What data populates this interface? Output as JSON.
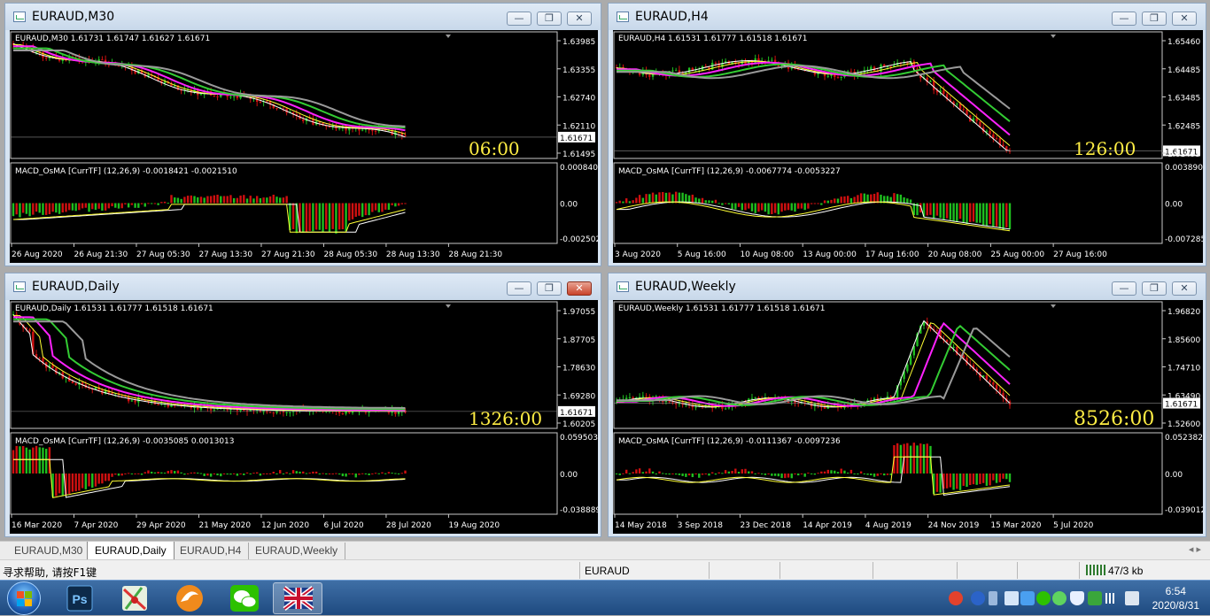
{
  "windows": [
    {
      "id": "m30",
      "title": "EURAUD,M30",
      "info": "EURAUD,M30  1.61731 1.61747 1.61627 1.61671",
      "prices": [
        "1.63985",
        "1.63355",
        "1.62740",
        "1.62110",
        "1.61495"
      ],
      "current_price": "1.61671",
      "countdown": "06:00",
      "macd_label": "MACD_OsMA [CurrTF] (12,26,9) -0.0018421 -0.0021510",
      "macd_scale": [
        "0.0008403",
        "0.00",
        "-0.002502"
      ],
      "dates": [
        "26 Aug 2020",
        "26 Aug 21:30",
        "27 Aug 05:30",
        "27 Aug 13:30",
        "27 Aug 21:30",
        "28 Aug 05:30",
        "28 Aug 13:30",
        "28 Aug 21:30"
      ],
      "active_close": false
    },
    {
      "id": "h4",
      "title": "EURAUD,H4",
      "info": "EURAUD,H4  1.61531 1.61777 1.61518 1.61671",
      "prices": [
        "1.65460",
        "1.64485",
        "1.63485",
        "1.62485",
        "1.61495"
      ],
      "current_price": "1.61671",
      "countdown": "126:00",
      "macd_label": "MACD_OsMA [CurrTF] (12,26,9) -0.0067774 -0.0053227",
      "macd_scale": [
        "0.0038903",
        "0.00",
        "-0.007285"
      ],
      "dates": [
        "3 Aug 2020",
        "5 Aug 16:00",
        "10 Aug 08:00",
        "13 Aug 00:00",
        "17 Aug 16:00",
        "20 Aug 08:00",
        "25 Aug 00:00",
        "27 Aug 16:00"
      ],
      "active_close": false
    },
    {
      "id": "daily",
      "title": "EURAUD,Daily",
      "info": "EURAUD,Daily  1.61531 1.61777 1.61518 1.61671",
      "prices": [
        "1.97055",
        "1.87705",
        "1.78630",
        "1.69280",
        "1.60205"
      ],
      "current_price": "1.61671",
      "countdown": "1326:00",
      "macd_label": "MACD_OsMA [CurrTF] (12,26,9) -0.0035085 0.0013013",
      "macd_scale": [
        "0.0595038",
        "0.00",
        "-0.038889"
      ],
      "dates": [
        "16 Mar 2020",
        "7 Apr 2020",
        "29 Apr 2020",
        "21 May 2020",
        "12 Jun 2020",
        "6 Jul 2020",
        "28 Jul 2020",
        "19 Aug 2020"
      ],
      "active_close": true
    },
    {
      "id": "weekly",
      "title": "EURAUD,Weekly",
      "info": "EURAUD,Weekly  1.61531 1.61777 1.61518 1.61671",
      "prices": [
        "1.96820",
        "1.85600",
        "1.74710",
        "1.63490",
        "1.52600"
      ],
      "current_price": "1.61671",
      "countdown": "8526:00",
      "macd_label": "MACD_OsMA [CurrTF] (12,26,9) -0.0111367 -0.0097236",
      "macd_scale": [
        "0.0523829",
        "0.00",
        "-0.039012"
      ],
      "dates": [
        "14 May 2018",
        "3 Sep 2018",
        "23 Dec 2018",
        "14 Apr 2019",
        "4 Aug 2019",
        "24 Nov 2019",
        "15 Mar 2020",
        "5 Jul 2020"
      ],
      "active_close": false
    }
  ],
  "window_buttons": {
    "minimize": "—",
    "restore": "❐",
    "close": "✕"
  },
  "tabs": [
    {
      "label": "EURAUD,M30",
      "active": false
    },
    {
      "label": "EURAUD,Daily",
      "active": true
    },
    {
      "label": "EURAUD,H4",
      "active": false
    },
    {
      "label": "EURAUD,Weekly",
      "active": false
    }
  ],
  "tab_arrows": "◂  ▸",
  "status": {
    "help": "寻求帮助, 请按F1键",
    "symbol": "EURAUD",
    "traffic": "47/3 kb"
  },
  "taskbar": {
    "time": "6:54",
    "date": "2020/8/31",
    "apps": [
      "Photoshop",
      "Maps",
      "Browser",
      "WeChat",
      "MetaTrader"
    ]
  },
  "colors": {
    "bull": "#1fbf1f",
    "bear": "#d01010",
    "ma_white": "#ffffff",
    "ma_yellow": "#ffff33",
    "ma_magenta": "#ff22ff",
    "ma_green": "#33cc33",
    "ma_gray": "#9a9a9a",
    "countdown": "#ffee44"
  }
}
